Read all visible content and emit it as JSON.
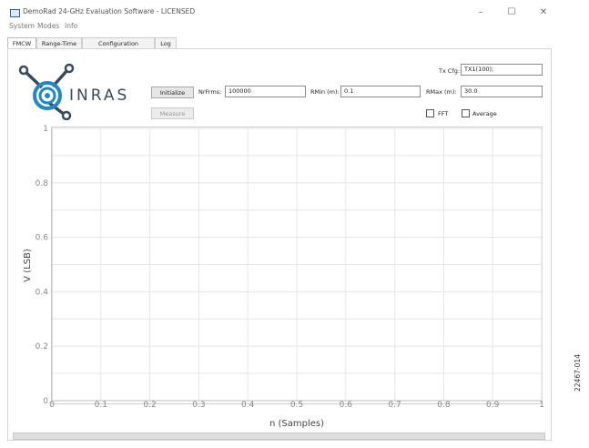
{
  "window": {
    "title": "DemoRad 24-GHz Evaluation Software - LICENSED",
    "controls": [
      "–",
      "☐",
      "✕"
    ]
  },
  "menu": [
    "System",
    "Modes",
    "Info"
  ],
  "tabs": [
    "FMCW",
    "Range-Time",
    "Configuration",
    "Log"
  ],
  "active_tab": "FMCW",
  "logo": {
    "text": "INRAS",
    "accent": "#1e88c8",
    "text_color": "#3a4a5a"
  },
  "controls": {
    "initialize_label": "Initialize",
    "measure_label": "Measure",
    "nrfrms_label": "NrFrms:",
    "nrfrms_value": "100000",
    "rmin_label": "RMin (m):",
    "rmin_value": "0.1",
    "txcfg_label": "Tx Cfg:",
    "txcfg_value": "TX1(100);",
    "rmax_label": "RMax (m):",
    "rmax_value": "30.0",
    "fft_label": "FFT",
    "average_label": "Average",
    "fft_checked": false,
    "average_checked": false
  },
  "chart_data": {
    "type": "line",
    "xlabel": "n (Samples)",
    "ylabel": "V (LSB)",
    "xlim": [
      0,
      1
    ],
    "ylim": [
      0,
      1
    ],
    "x_ticks": [
      "0",
      "0.1",
      "0.2",
      "0.3",
      "0.4",
      "0.5",
      "0.6",
      "0.7",
      "0.8",
      "0.9",
      "1"
    ],
    "y_ticks": [
      "0",
      "0.2",
      "0.4",
      "0.6",
      "0.8",
      "1"
    ],
    "grid": true,
    "series": []
  },
  "figure_id": "22467-014"
}
